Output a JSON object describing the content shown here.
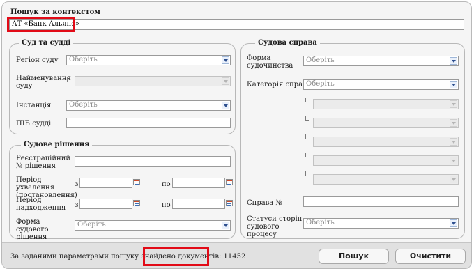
{
  "search": {
    "label": "Пошук за контекстом",
    "value": "АТ «Банк Альянс»"
  },
  "court_section": {
    "legend": "Суд та судді",
    "region_label": "Регіон суду",
    "region_value": "Оберіть",
    "court_name_label": "Найменування суду",
    "instance_label": "Інстанція",
    "instance_value": "Оберіть",
    "judge_label": "ПІБ судді"
  },
  "decision_section": {
    "legend": "Судове рішення",
    "reg_number_label": "Реєстраційний № рішення",
    "adoption_period_label": "Період ухвалення (постановлення)",
    "receipt_period_label": "Період надходження",
    "from_label": "з",
    "to_label": "по",
    "form_label": "Форма судового рішення",
    "form_value": "Оберіть"
  },
  "case_section": {
    "legend": "Судова справа",
    "proceeding_form_label": "Форма судочинства",
    "proceeding_form_value": "Оберіть",
    "category_label": "Категорія справи",
    "category_value": "Оберіть",
    "case_number_label": "Справа №",
    "party_status_label": "Статуси сторін судового процесу",
    "party_status_value": "Оберіть"
  },
  "footer": {
    "result_prefix": "За заданими параметрами пошуку знайдено ",
    "result_highlight": "документів: 11452",
    "search_button": "Пошук",
    "clear_button": "Очистити"
  },
  "colors": {
    "highlight_box": "#e20b17",
    "dropdown_arrow": "#2d4f8f"
  },
  "icons": [
    "dropdown-arrow-icon",
    "calendar-icon",
    "tree-branch-icon"
  ]
}
